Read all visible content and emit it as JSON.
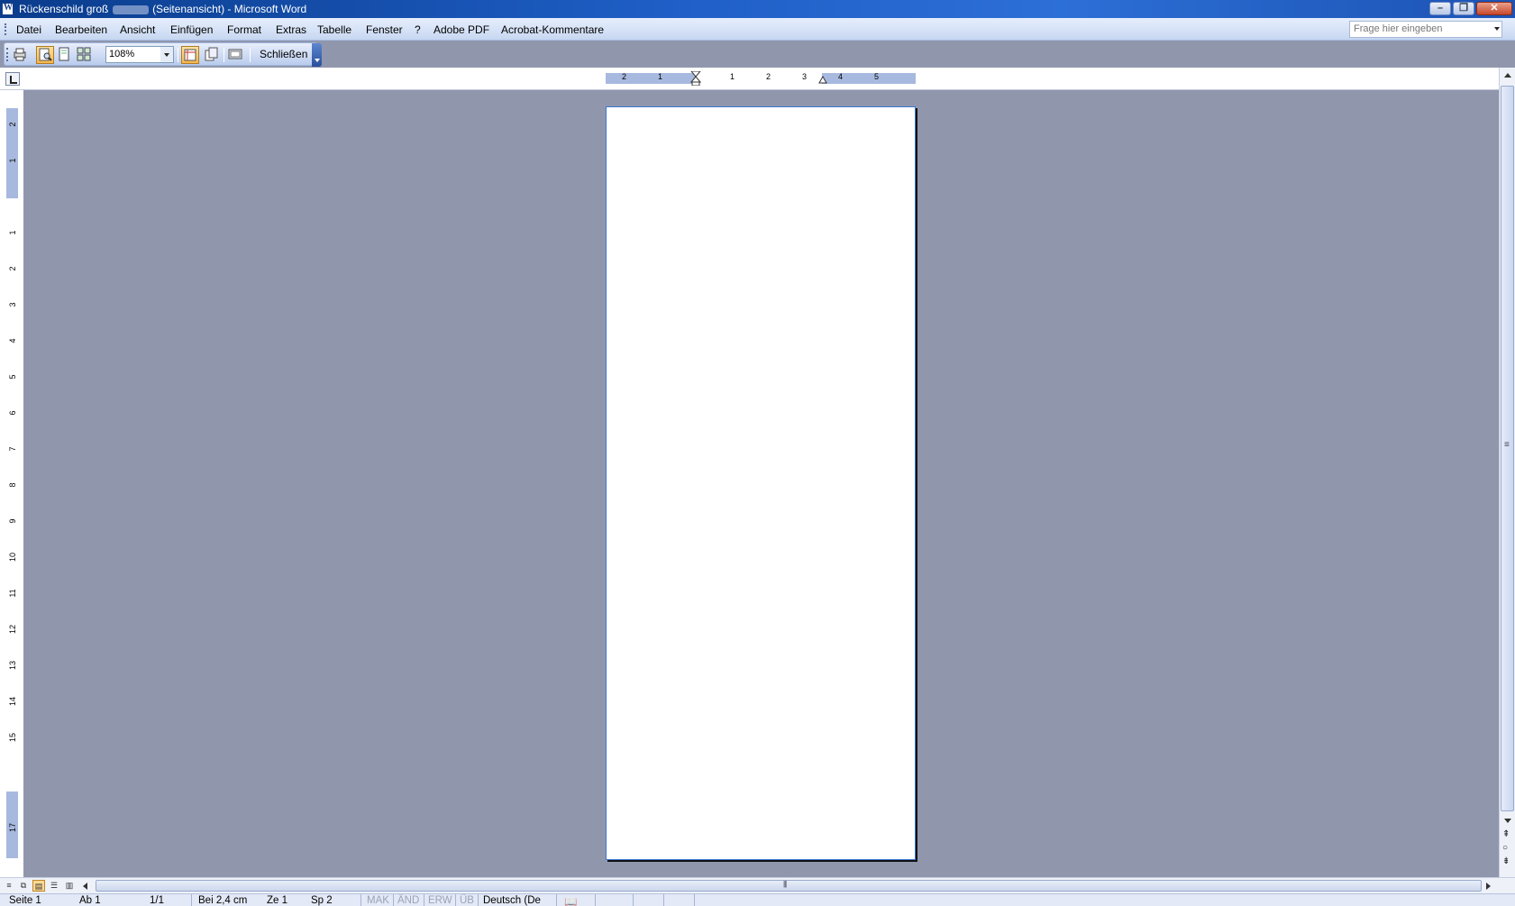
{
  "window": {
    "title_prefix": "Rückenschild groß",
    "title_suffix": "(Seitenansicht) - Microsoft Word",
    "minimize": "–",
    "restore": "❐",
    "close": "✕"
  },
  "menu": {
    "items": [
      "Datei",
      "Bearbeiten",
      "Ansicht",
      "Einfügen",
      "Format",
      "Extras",
      "Tabelle",
      "Fenster",
      "?",
      "Adobe PDF",
      "Acrobat-Kommentare"
    ],
    "ask_placeholder": "Frage hier eingeben"
  },
  "toolbar": {
    "zoom_value": "108%",
    "close_label": "Schließen",
    "icons": [
      "print-icon",
      "magnifier-icon",
      "one-page-icon",
      "multiple-pages-icon",
      "view-ruler-icon",
      "shrink-to-fit-icon",
      "full-screen-icon"
    ]
  },
  "ruler": {
    "horizontal_ticks": [
      "2",
      "1",
      "1",
      "2",
      "3",
      "4",
      "5"
    ],
    "vertical_ticks": [
      "2",
      "1",
      "1",
      "2",
      "3",
      "4",
      "5",
      "6",
      "7",
      "8",
      "9",
      "10",
      "11",
      "12",
      "13",
      "14",
      "15",
      "17"
    ]
  },
  "statusbar": {
    "page": "Seite 1",
    "section": "Ab 1",
    "page_of": "1/1",
    "at": "Bei 2,4 cm",
    "line": "Ze 1",
    "column": "Sp 2",
    "rec": "MAK",
    "trk": "ÄND",
    "ext": "ERW",
    "ovr": "ÜB",
    "language": "Deutsch (De"
  },
  "colors": {
    "workspace": "#9097ad",
    "titlebar": "#1f5fc7",
    "toolbar": "#c7d7f1",
    "page_border": "#3a78d4"
  }
}
